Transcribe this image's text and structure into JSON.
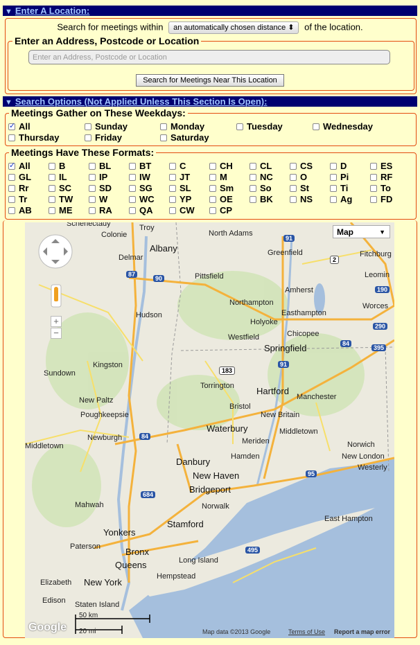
{
  "location_section": {
    "header_label": "Enter A Location:",
    "search_prefix": "Search for meetings within",
    "distance_select": "an automatically chosen distance",
    "search_suffix": "of the location.",
    "address_legend": "Enter an Address, Postcode or Location",
    "address_placeholder": "Enter an Address, Postcode or Location",
    "search_button": "Search for Meetings Near This Location"
  },
  "options_section": {
    "header_label": "Search Options (Not Applied Unless This Section Is Open):",
    "weekdays_legend": "Meetings Gather on These Weekdays:",
    "weekdays": [
      {
        "label": "All",
        "checked": true
      },
      {
        "label": "Sunday",
        "checked": false
      },
      {
        "label": "Monday",
        "checked": false
      },
      {
        "label": "Tuesday",
        "checked": false
      },
      {
        "label": "Wednesday",
        "checked": false
      },
      {
        "label": "Thursday",
        "checked": false
      },
      {
        "label": "Friday",
        "checked": false
      },
      {
        "label": "Saturday",
        "checked": false
      }
    ],
    "formats_legend": "Meetings Have These Formats:",
    "formats": [
      {
        "label": "All",
        "checked": true
      },
      {
        "label": "B"
      },
      {
        "label": "BL"
      },
      {
        "label": "BT"
      },
      {
        "label": "C"
      },
      {
        "label": "CH"
      },
      {
        "label": "CL"
      },
      {
        "label": "CS"
      },
      {
        "label": "D"
      },
      {
        "label": "ES"
      },
      {
        "label": "GL"
      },
      {
        "label": "IL"
      },
      {
        "label": "IP"
      },
      {
        "label": "IW"
      },
      {
        "label": "JT"
      },
      {
        "label": "M"
      },
      {
        "label": "NC"
      },
      {
        "label": "O"
      },
      {
        "label": "Pi"
      },
      {
        "label": "RF"
      },
      {
        "label": "Rr"
      },
      {
        "label": "SC"
      },
      {
        "label": "SD"
      },
      {
        "label": "SG"
      },
      {
        "label": "SL"
      },
      {
        "label": "Sm"
      },
      {
        "label": "So"
      },
      {
        "label": "St"
      },
      {
        "label": "Ti"
      },
      {
        "label": "To"
      },
      {
        "label": "Tr"
      },
      {
        "label": "TW"
      },
      {
        "label": "W"
      },
      {
        "label": "WC"
      },
      {
        "label": "YP"
      },
      {
        "label": "OE"
      },
      {
        "label": "BK"
      },
      {
        "label": "NS"
      },
      {
        "label": "Ag"
      },
      {
        "label": "FD"
      },
      {
        "label": "AB"
      },
      {
        "label": "ME"
      },
      {
        "label": "RA"
      },
      {
        "label": "QA"
      },
      {
        "label": "CW"
      },
      {
        "label": "CP"
      }
    ]
  },
  "map": {
    "type_button": "Map",
    "places": [
      "Schenectady",
      "Troy",
      "Colonie",
      "Albany",
      "Delmar",
      "Pittsfield",
      "North Adams",
      "Greenfield",
      "Fitchburg",
      "Leomin",
      "Amherst",
      "Northampton",
      "Easthampton",
      "Worces",
      "Holyoke",
      "Chicopee",
      "Westfield",
      "Springfield",
      "Hudson",
      "Kingston",
      "Sundown",
      "Torrington",
      "Hartford",
      "Manchester",
      "Bristol",
      "New Britain",
      "New Paltz",
      "Poughkeepsie",
      "Waterbury",
      "Meriden",
      "Middletown",
      "Newburgh",
      "Middletown",
      "Danbury",
      "Hamden",
      "Norwich",
      "New London",
      "Westerly",
      "New Haven",
      "Bridgeport",
      "Mahwah",
      "Norwalk",
      "Stamford",
      "East Hampton",
      "Yonkers",
      "Paterson",
      "Bronx",
      "Long Island",
      "Queens",
      "Hempstead",
      "Elizabeth",
      "New York",
      "Edison",
      "Staten Island"
    ],
    "highways": [
      "91",
      "2",
      "87",
      "90",
      "190",
      "290",
      "84",
      "395",
      "183",
      "91",
      "84",
      "684",
      "95",
      "495"
    ],
    "scale_km": "50 km",
    "scale_mi": "20 mi",
    "attribution": "Map data ©2013 Google",
    "terms": "Terms of Use",
    "report": "Report a map error",
    "logo": "Google"
  }
}
